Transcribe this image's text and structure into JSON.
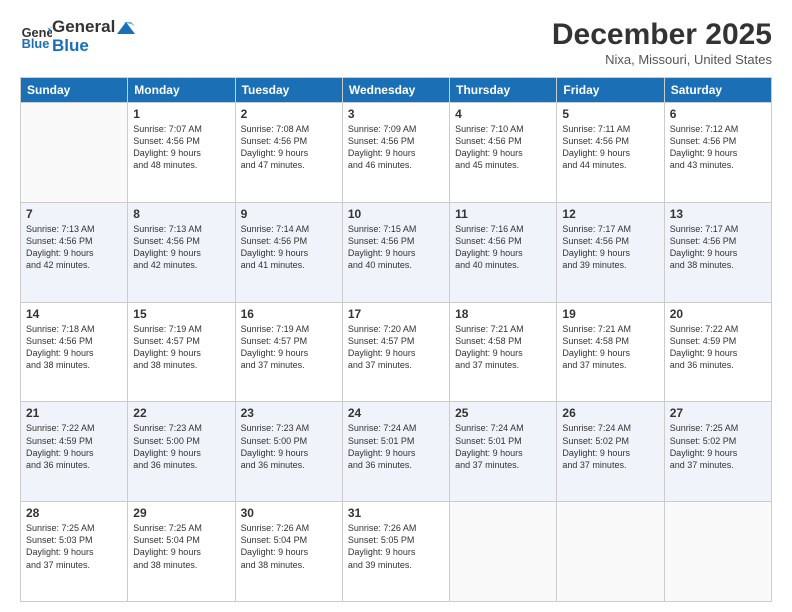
{
  "header": {
    "logo_general": "General",
    "logo_blue": "Blue",
    "month": "December 2025",
    "location": "Nixa, Missouri, United States"
  },
  "days_of_week": [
    "Sunday",
    "Monday",
    "Tuesday",
    "Wednesday",
    "Thursday",
    "Friday",
    "Saturday"
  ],
  "weeks": [
    [
      {
        "day": "",
        "info": ""
      },
      {
        "day": "1",
        "info": "Sunrise: 7:07 AM\nSunset: 4:56 PM\nDaylight: 9 hours\nand 48 minutes."
      },
      {
        "day": "2",
        "info": "Sunrise: 7:08 AM\nSunset: 4:56 PM\nDaylight: 9 hours\nand 47 minutes."
      },
      {
        "day": "3",
        "info": "Sunrise: 7:09 AM\nSunset: 4:56 PM\nDaylight: 9 hours\nand 46 minutes."
      },
      {
        "day": "4",
        "info": "Sunrise: 7:10 AM\nSunset: 4:56 PM\nDaylight: 9 hours\nand 45 minutes."
      },
      {
        "day": "5",
        "info": "Sunrise: 7:11 AM\nSunset: 4:56 PM\nDaylight: 9 hours\nand 44 minutes."
      },
      {
        "day": "6",
        "info": "Sunrise: 7:12 AM\nSunset: 4:56 PM\nDaylight: 9 hours\nand 43 minutes."
      }
    ],
    [
      {
        "day": "7",
        "info": "Sunrise: 7:13 AM\nSunset: 4:56 PM\nDaylight: 9 hours\nand 42 minutes."
      },
      {
        "day": "8",
        "info": "Sunrise: 7:13 AM\nSunset: 4:56 PM\nDaylight: 9 hours\nand 42 minutes."
      },
      {
        "day": "9",
        "info": "Sunrise: 7:14 AM\nSunset: 4:56 PM\nDaylight: 9 hours\nand 41 minutes."
      },
      {
        "day": "10",
        "info": "Sunrise: 7:15 AM\nSunset: 4:56 PM\nDaylight: 9 hours\nand 40 minutes."
      },
      {
        "day": "11",
        "info": "Sunrise: 7:16 AM\nSunset: 4:56 PM\nDaylight: 9 hours\nand 40 minutes."
      },
      {
        "day": "12",
        "info": "Sunrise: 7:17 AM\nSunset: 4:56 PM\nDaylight: 9 hours\nand 39 minutes."
      },
      {
        "day": "13",
        "info": "Sunrise: 7:17 AM\nSunset: 4:56 PM\nDaylight: 9 hours\nand 38 minutes."
      }
    ],
    [
      {
        "day": "14",
        "info": "Sunrise: 7:18 AM\nSunset: 4:56 PM\nDaylight: 9 hours\nand 38 minutes."
      },
      {
        "day": "15",
        "info": "Sunrise: 7:19 AM\nSunset: 4:57 PM\nDaylight: 9 hours\nand 38 minutes."
      },
      {
        "day": "16",
        "info": "Sunrise: 7:19 AM\nSunset: 4:57 PM\nDaylight: 9 hours\nand 37 minutes."
      },
      {
        "day": "17",
        "info": "Sunrise: 7:20 AM\nSunset: 4:57 PM\nDaylight: 9 hours\nand 37 minutes."
      },
      {
        "day": "18",
        "info": "Sunrise: 7:21 AM\nSunset: 4:58 PM\nDaylight: 9 hours\nand 37 minutes."
      },
      {
        "day": "19",
        "info": "Sunrise: 7:21 AM\nSunset: 4:58 PM\nDaylight: 9 hours\nand 37 minutes."
      },
      {
        "day": "20",
        "info": "Sunrise: 7:22 AM\nSunset: 4:59 PM\nDaylight: 9 hours\nand 36 minutes."
      }
    ],
    [
      {
        "day": "21",
        "info": "Sunrise: 7:22 AM\nSunset: 4:59 PM\nDaylight: 9 hours\nand 36 minutes."
      },
      {
        "day": "22",
        "info": "Sunrise: 7:23 AM\nSunset: 5:00 PM\nDaylight: 9 hours\nand 36 minutes."
      },
      {
        "day": "23",
        "info": "Sunrise: 7:23 AM\nSunset: 5:00 PM\nDaylight: 9 hours\nand 36 minutes."
      },
      {
        "day": "24",
        "info": "Sunrise: 7:24 AM\nSunset: 5:01 PM\nDaylight: 9 hours\nand 36 minutes."
      },
      {
        "day": "25",
        "info": "Sunrise: 7:24 AM\nSunset: 5:01 PM\nDaylight: 9 hours\nand 37 minutes."
      },
      {
        "day": "26",
        "info": "Sunrise: 7:24 AM\nSunset: 5:02 PM\nDaylight: 9 hours\nand 37 minutes."
      },
      {
        "day": "27",
        "info": "Sunrise: 7:25 AM\nSunset: 5:02 PM\nDaylight: 9 hours\nand 37 minutes."
      }
    ],
    [
      {
        "day": "28",
        "info": "Sunrise: 7:25 AM\nSunset: 5:03 PM\nDaylight: 9 hours\nand 37 minutes."
      },
      {
        "day": "29",
        "info": "Sunrise: 7:25 AM\nSunset: 5:04 PM\nDaylight: 9 hours\nand 38 minutes."
      },
      {
        "day": "30",
        "info": "Sunrise: 7:26 AM\nSunset: 5:04 PM\nDaylight: 9 hours\nand 38 minutes."
      },
      {
        "day": "31",
        "info": "Sunrise: 7:26 AM\nSunset: 5:05 PM\nDaylight: 9 hours\nand 39 minutes."
      },
      {
        "day": "",
        "info": ""
      },
      {
        "day": "",
        "info": ""
      },
      {
        "day": "",
        "info": ""
      }
    ]
  ]
}
